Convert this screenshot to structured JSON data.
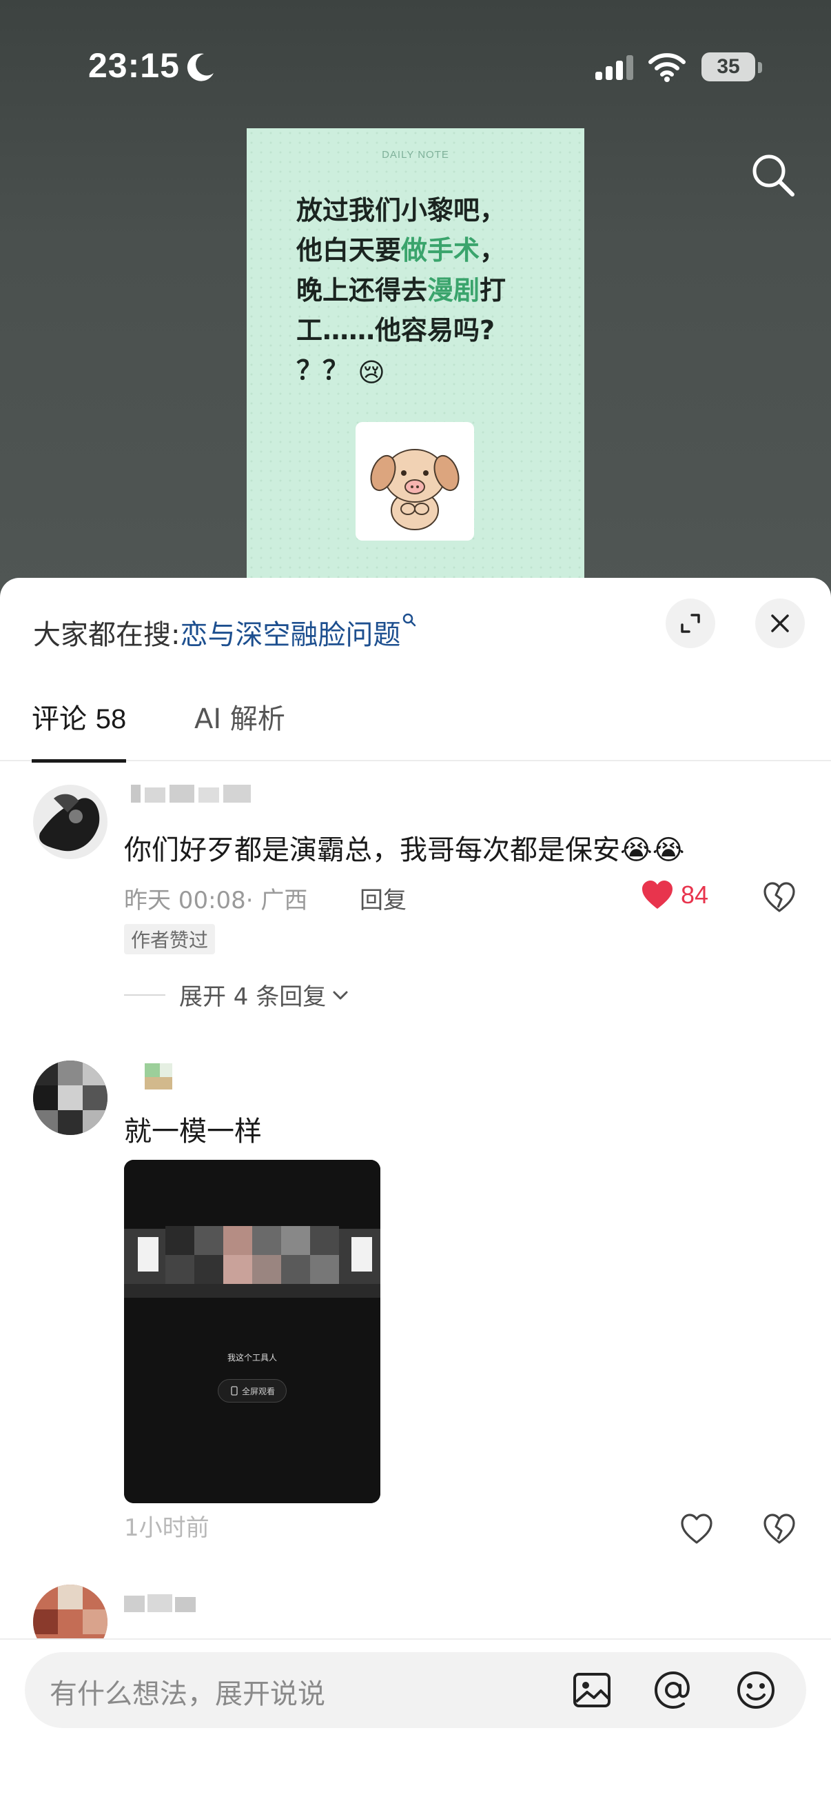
{
  "status_bar": {
    "time": "23:15",
    "battery": "35"
  },
  "note_card": {
    "label": "DAILY NOTE",
    "line1": "放过我们小黎吧，",
    "line2_a": "他白天要",
    "line2_b": "做手术",
    "line2_c": "，",
    "line3_a": "晚上还得去",
    "line3_b": "漫剧",
    "line3_c": "打",
    "line4": "工……他容易吗?",
    "line5": "？？",
    "emoji": "😢"
  },
  "hot_search": {
    "label": "大家都在搜",
    "colon": ":",
    "query": "恋与深空融脸问题"
  },
  "tabs": {
    "comments_label": "评论",
    "comments_count": "58",
    "ai_label": "AI 解析"
  },
  "comments": [
    {
      "text": "你们好歹都是演霸总，我哥每次都是保安😭😭",
      "time": "昨天 00:08",
      "location": "· 广西",
      "reply_label": "回复",
      "likes": "84",
      "badge": "作者赞过",
      "expand_replies": "展开 4 条回复"
    },
    {
      "text": "就一模一样",
      "time": "1小时前",
      "video_caption": "我这个工具人",
      "video_button": "全屏观看"
    }
  ],
  "input": {
    "placeholder": "有什么想法，展开说说"
  },
  "colors": {
    "accent_link": "#1d4f8f",
    "like_red": "#e8344d",
    "note_bg": "#cdeedd",
    "note_highlight": "#3aa46c"
  }
}
